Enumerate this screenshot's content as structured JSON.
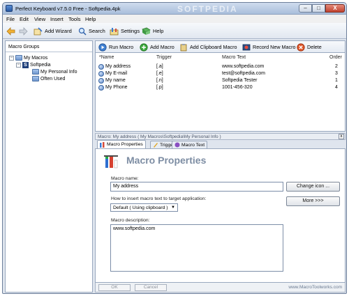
{
  "window": {
    "title": "Perfect Keyboard v7.5.0 Free - Softpedia.4pk",
    "watermark": "SOFTPEDIA",
    "minimize": "–",
    "maximize": "□",
    "close": "X"
  },
  "menu": [
    "File",
    "Edit",
    "View",
    "Insert",
    "Tools",
    "Help"
  ],
  "toolbar": {
    "add_wizard": "Add Wizard",
    "search": "Search",
    "settings": "Settings",
    "help": "Help"
  },
  "macro_groups": {
    "header": "Macro Groups",
    "tree": [
      {
        "label": "My Macros",
        "expander": "−"
      },
      {
        "label": "Softpedia",
        "badge": "S",
        "expander": "−"
      },
      {
        "label": "My Personal Info"
      },
      {
        "label": "Often Used"
      }
    ]
  },
  "macro_toolbar": {
    "run": "Run Macro",
    "add": "Add Macro",
    "add_clipboard": "Add Clipboard Macro",
    "record": "Record New Macro",
    "delete": "Delete"
  },
  "macro_list": {
    "columns": {
      "name": "*Name",
      "trigger": "Trigger",
      "text": "Macro Text",
      "order": "Order"
    },
    "rows": [
      {
        "name": "My address",
        "trigger": "[.a]",
        "text": "www.softpedia.com",
        "order": "2"
      },
      {
        "name": "My E-mail",
        "trigger": "[.e]",
        "text": "test@softpedia.com",
        "order": "3"
      },
      {
        "name": "My name",
        "trigger": "[.n]",
        "text": "Softpedia Tester",
        "order": "1"
      },
      {
        "name": "My Phone",
        "trigger": "[.p]",
        "text": "1001-456-320",
        "order": "4"
      }
    ]
  },
  "details": {
    "path": "Macro: My address ( My Macros\\Softpedia\\My Personal Info )",
    "close": "x",
    "tabs": [
      "Macro Properties",
      "Trigger",
      "Macro Text"
    ],
    "title": "Macro Properties",
    "name_label": "Macro name:",
    "name_value": "My address",
    "change_icon": "Change icon ...",
    "insert_label": "How to insert macro text to target application:",
    "insert_value": "Default ( Using clipboard )",
    "more": "More >>>",
    "desc_label": "Macro description:",
    "desc_value": "www.softpedia.com"
  },
  "footer": {
    "ok": "OK",
    "cancel": "Cancel",
    "site": "www.MacroToolworks.com"
  }
}
